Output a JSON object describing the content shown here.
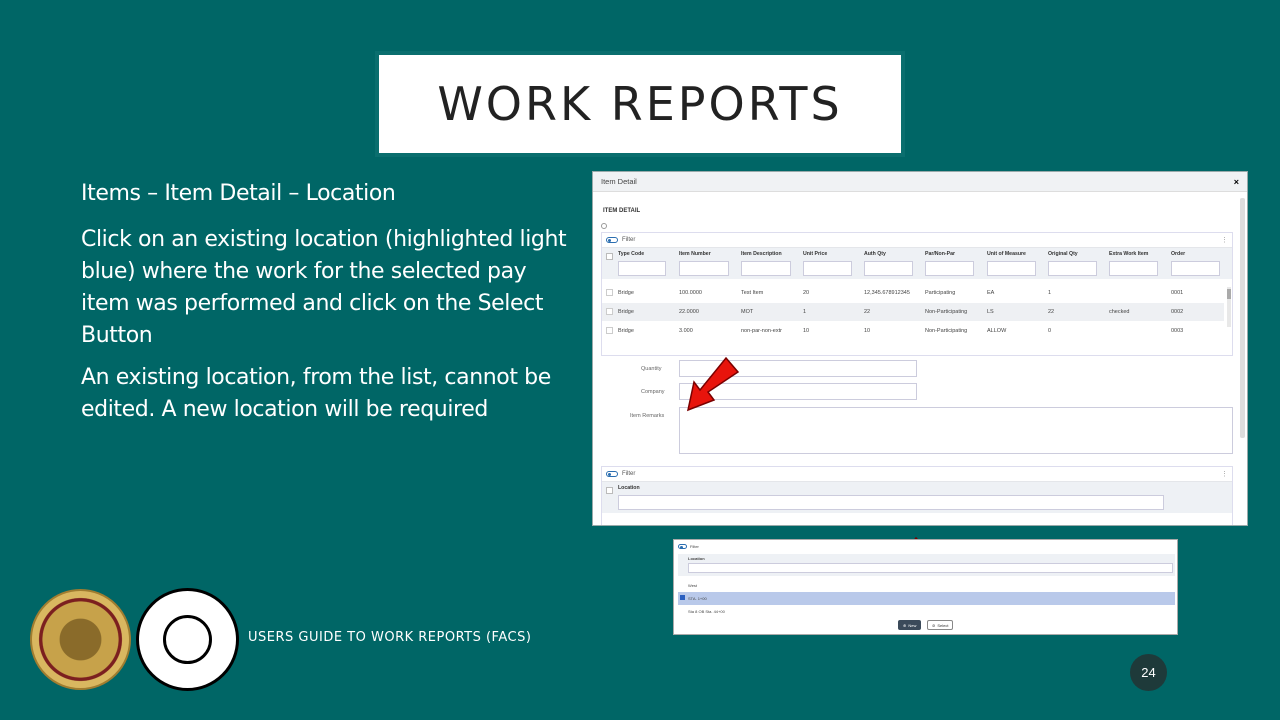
{
  "slide": {
    "title": "WORK REPORTS",
    "heading": "Items – Item Detail – Location",
    "para1": "Click on an existing location (highlighted light blue) where the work for the selected pay item was performed and click on the Select Button",
    "para2": "An existing location, from the list, cannot be edited.  A new location will be required",
    "footer": "USERS GUIDE TO WORK REPORTS  (FACS)",
    "page_number": "24"
  },
  "dialog": {
    "title": "Item Detail",
    "close": "×",
    "section": "ITEM DETAIL",
    "filter_label": "Filter",
    "columns": [
      "Type Code",
      "Item Number",
      "Item Description",
      "Unit Price",
      "Auth Qty",
      "Par/Non-Par",
      "Unit of Measure",
      "Original Qty",
      "Extra Work Item",
      "Order"
    ],
    "rows": [
      [
        "Bridge",
        "100.0000",
        "Test Item",
        "20",
        "12,345.678912345",
        "Participating",
        "EA",
        "1",
        "",
        "0001"
      ],
      [
        "Bridge",
        "22.0000",
        "MOT",
        "1",
        "22",
        "Non-Participating",
        "LS",
        "22",
        "checked",
        "0002"
      ],
      [
        "Bridge",
        "3.000",
        "non-par-non-extr",
        "10",
        "10",
        "Non-Participating",
        "ALLOW",
        "0",
        "",
        "0003"
      ]
    ],
    "quantity_label": "Quantity",
    "company_label": "Company",
    "remarks_label": "Item Remarks",
    "location_col": "Location"
  },
  "location_panel": {
    "filter_label": "Filter",
    "location_col": "Location",
    "rows": [
      "West",
      "STA. 1+00",
      "Sta 8 OB Sta. 44+00"
    ],
    "selected_index": 1,
    "new_label": "New",
    "select_label": "Select"
  }
}
